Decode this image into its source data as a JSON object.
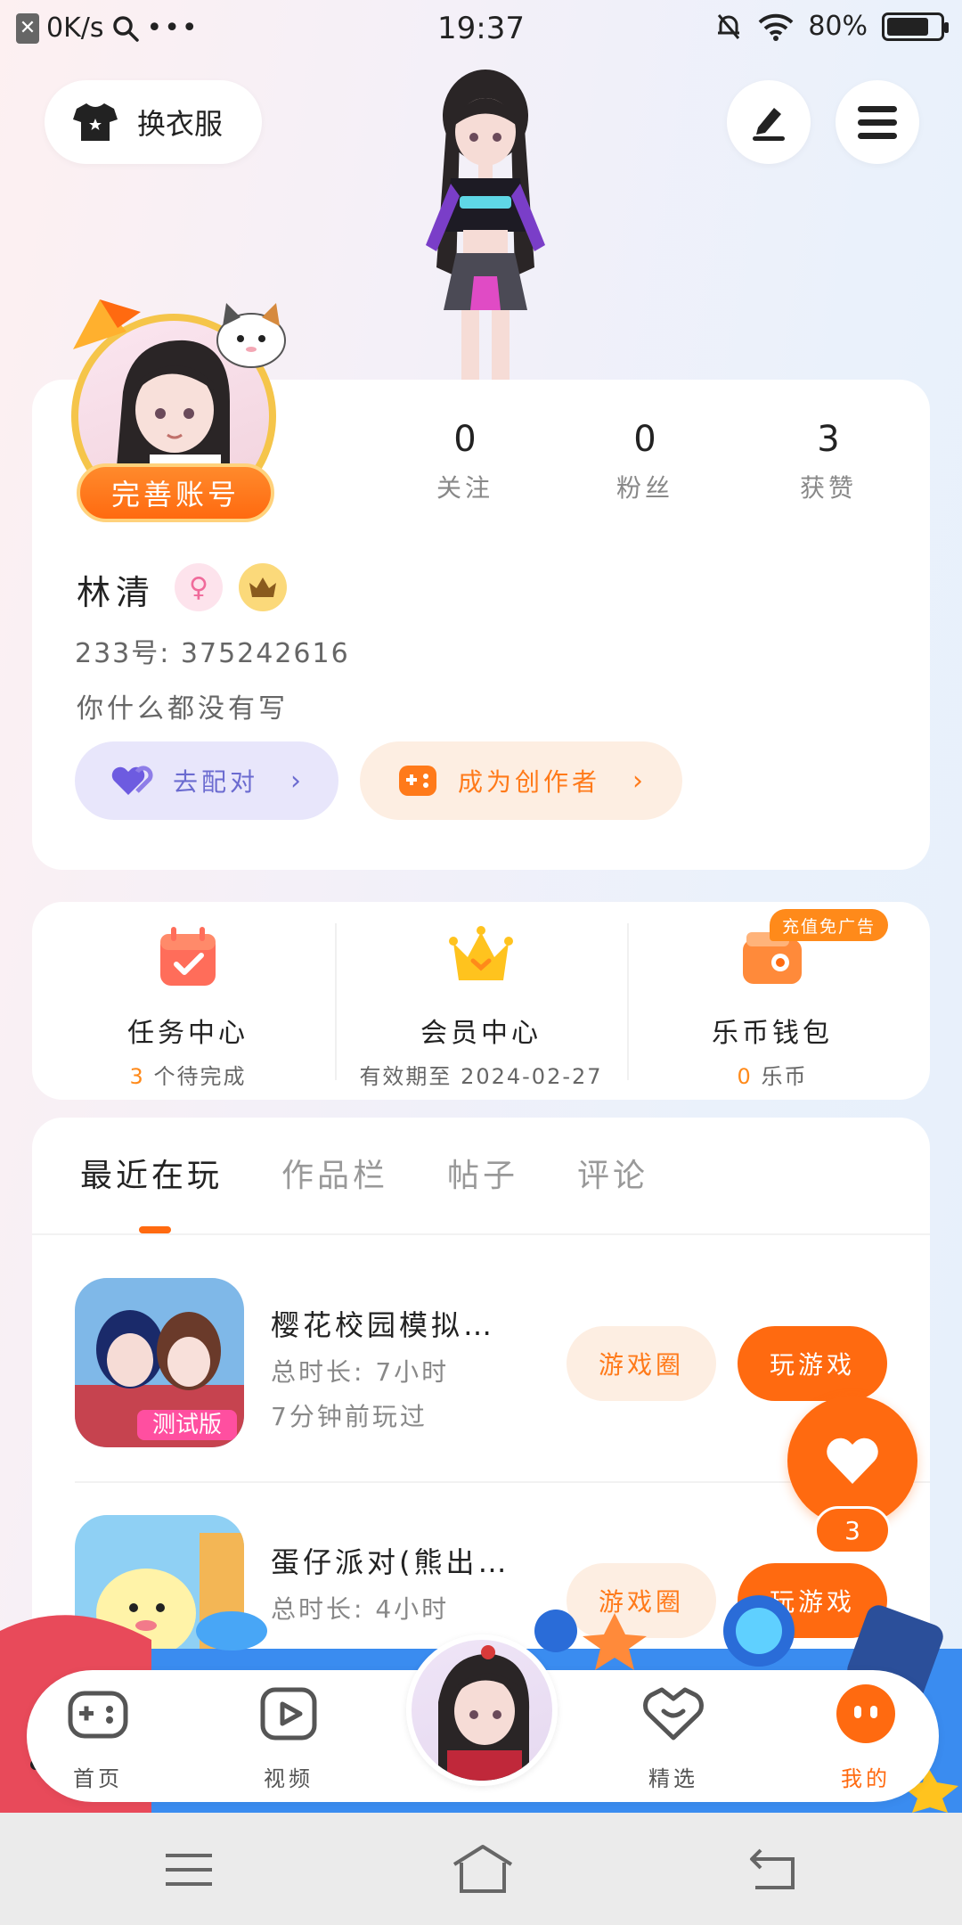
{
  "status": {
    "speed": "0K/s",
    "time": "19:37",
    "battery": "80%"
  },
  "header": {
    "dress_label": "换衣服"
  },
  "profile": {
    "complete_label": "完善账号",
    "stats": [
      {
        "value": "0",
        "label": "关注"
      },
      {
        "value": "0",
        "label": "粉丝"
      },
      {
        "value": "3",
        "label": "获赞"
      }
    ],
    "name": "林清",
    "uid": "233号: 375242616",
    "bio": "你什么都没有写",
    "match_label": "去配对",
    "creator_label": "成为创作者"
  },
  "services": [
    {
      "title": "任务中心",
      "count": "3",
      "suffix": " 个待完成"
    },
    {
      "title": "会员中心",
      "sub": "有效期至 2024-02-27"
    },
    {
      "title": "乐币钱包",
      "count": "0",
      "suffix": " 乐币",
      "badge": "充值免广告"
    }
  ],
  "tabs": [
    "最近在玩",
    "作品栏",
    "帖子",
    "评论"
  ],
  "games": [
    {
      "title": "樱花校园模拟…",
      "duration": "总时长: 7小时",
      "last_played": "7分钟前玩过",
      "icon_tag": "测试版",
      "circle_label": "游戏圈",
      "play_label": "玩游戏"
    },
    {
      "title": "蛋仔派对(熊出…",
      "duration": "总时长: 4小时",
      "last_played": "",
      "circle_label": "游戏圈",
      "play_label": "玩游戏"
    }
  ],
  "fab": {
    "count": "3"
  },
  "nav": [
    "首页",
    "视频",
    "精选",
    "我的"
  ],
  "colors": {
    "accent": "#ff6a10",
    "accent_light": "#fdeee2",
    "match_bg": "#e8e6fb"
  }
}
